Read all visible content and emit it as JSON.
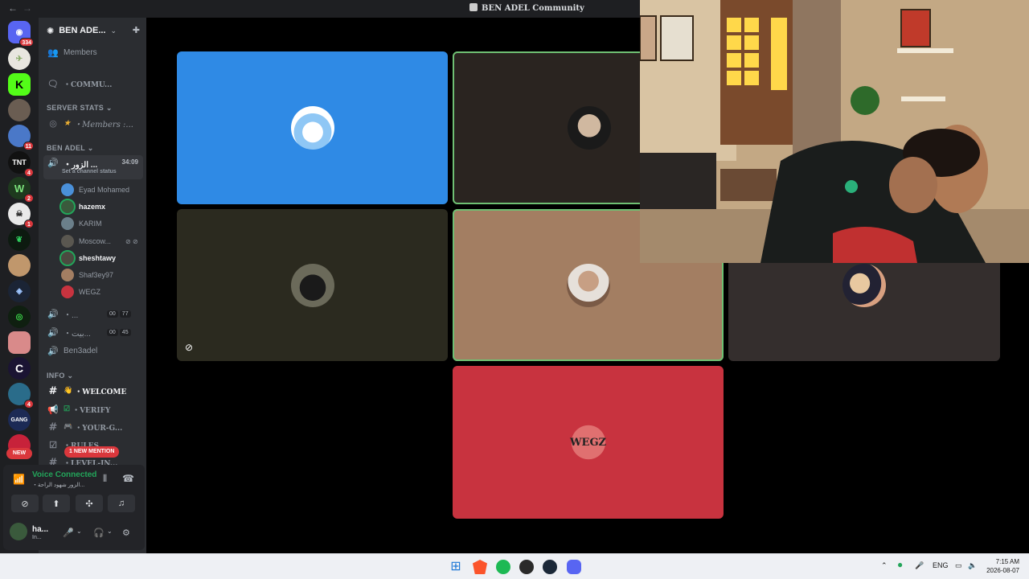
{
  "window": {
    "title": "BEN ADEL Community"
  },
  "rail": {
    "home_badge": "334",
    "badges": [
      "11",
      "4",
      "2",
      "1",
      "4"
    ],
    "new_label": "NEW"
  },
  "sidebar": {
    "server_name": "BEN ADE...",
    "members_label": "Members",
    "community_channel": "・COMMU...",
    "cat_server_stats": "SERVER STATS",
    "members_stat": "・Members :...",
    "cat_ben_adel": "BEN ADEL",
    "active_voice": "・الزور ...",
    "active_timer": "34:09",
    "set_status": "Set a channel status",
    "users": [
      "Eyad Mohamed",
      "hazemx",
      "KARIM",
      "Moscow...",
      "sheshtawy",
      "Shaf3ey97",
      "WEGZ"
    ],
    "voice2": "・...",
    "voice2_counts": [
      "00",
      "77"
    ],
    "voice3": "・بيت...",
    "voice3_counts": [
      "00",
      "45"
    ],
    "voice4": "Ben3adel",
    "cat_info": "INFO",
    "text_channels": [
      "・WELCOME",
      "・VERIFY",
      "・YOUR-G...",
      "・RULES",
      "・LEVEL-IN..."
    ],
    "mention_label": "1 NEW MENTION"
  },
  "voice_panel": {
    "status": "Voice Connected",
    "sub": "・الزور شهود الراحة...",
    "username": "ha...",
    "user_status": "In..."
  },
  "taskbar": {
    "lang": "ENG",
    "time": "7:15 AM",
    "date": "2026-08-07"
  },
  "colors": {
    "tile_blue": "#2f8ae5",
    "tile_dark": "#2a2420",
    "tile_olive": "#2b2a1f",
    "tile_tan": "#a37e62",
    "tile_brown": "#342e2d",
    "tile_red": "#c8333f",
    "speaking": "#6fbf73",
    "voice_green": "#23a55a",
    "badge_red": "#da373c"
  }
}
